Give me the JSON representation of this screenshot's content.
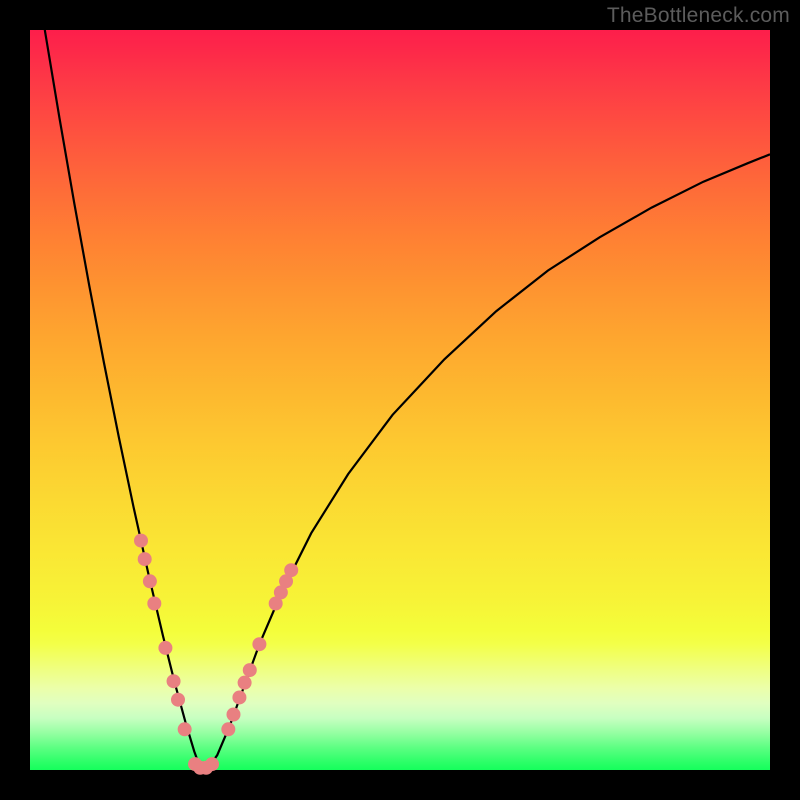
{
  "watermark": "TheBottleneck.com",
  "colors": {
    "frame": "#000000",
    "watermark": "#5c5c5c",
    "curve": "#000000",
    "marker_fill": "#e98081",
    "marker_stroke": "#e98081"
  },
  "chart_data": {
    "type": "line",
    "title": "",
    "xlabel": "",
    "ylabel": "",
    "xlim": [
      0,
      100
    ],
    "ylim": [
      0,
      100
    ],
    "grid": false,
    "legend": false,
    "series": [
      {
        "name": "bottleneck-curve",
        "x": [
          2,
          4,
          6,
          8,
          10,
          12,
          14,
          16,
          18,
          19.5,
          21,
          22.2,
          23,
          24,
          25.3,
          27,
          29,
          31,
          34,
          38,
          43,
          49,
          56,
          63,
          70,
          77,
          84,
          91,
          97,
          100
        ],
        "y": [
          100,
          88,
          76.5,
          65.5,
          55,
          45,
          35.5,
          26.5,
          18,
          12,
          6.5,
          2.5,
          0.3,
          0.2,
          2,
          6,
          11.5,
          17,
          24,
          32,
          40,
          48,
          55.5,
          62,
          67.5,
          72,
          76,
          79.5,
          82,
          83.2
        ]
      }
    ],
    "markers": [
      {
        "x": 15.0,
        "y": 31.0
      },
      {
        "x": 15.5,
        "y": 28.5
      },
      {
        "x": 16.2,
        "y": 25.5
      },
      {
        "x": 16.8,
        "y": 22.5
      },
      {
        "x": 18.3,
        "y": 16.5
      },
      {
        "x": 19.4,
        "y": 12.0
      },
      {
        "x": 20.0,
        "y": 9.5
      },
      {
        "x": 20.9,
        "y": 5.5
      },
      {
        "x": 22.3,
        "y": 0.8
      },
      {
        "x": 23.0,
        "y": 0.3
      },
      {
        "x": 23.8,
        "y": 0.3
      },
      {
        "x": 24.6,
        "y": 0.8
      },
      {
        "x": 26.8,
        "y": 5.5
      },
      {
        "x": 27.5,
        "y": 7.5
      },
      {
        "x": 28.3,
        "y": 9.8
      },
      {
        "x": 29.0,
        "y": 11.8
      },
      {
        "x": 29.7,
        "y": 13.5
      },
      {
        "x": 31.0,
        "y": 17.0
      },
      {
        "x": 33.2,
        "y": 22.5
      },
      {
        "x": 33.9,
        "y": 24.0
      },
      {
        "x": 34.6,
        "y": 25.5
      },
      {
        "x": 35.3,
        "y": 27.0
      }
    ],
    "marker_radius": 7
  }
}
